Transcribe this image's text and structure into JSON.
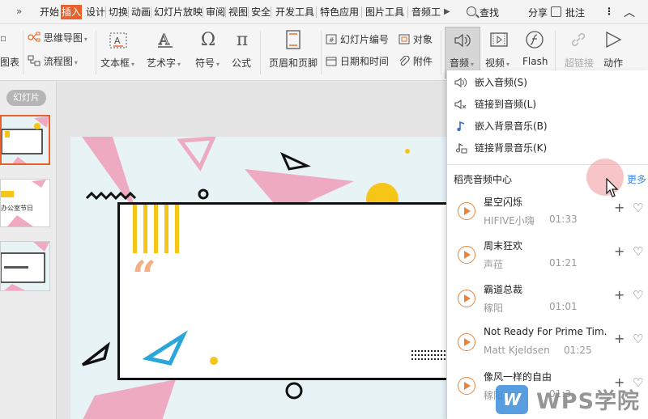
{
  "tabs": [
    "开始",
    "插入",
    "设计",
    "切换",
    "动画",
    "幻灯片放映",
    "审阅",
    "视图",
    "安全",
    "开发工具",
    "特色应用",
    "图片工具",
    "音频工"
  ],
  "active_tab": "插入",
  "tabbar_right": {
    "search": "查找",
    "share": "分享",
    "comment": "批注"
  },
  "ribbon": {
    "mindmap": "思维导图",
    "flowchart": "流程图",
    "chart_partial": "图表",
    "textbox": "文本框",
    "wordart": "艺术字",
    "symbol": "符号",
    "formula": "公式",
    "header_footer": "页眉和页脚",
    "slide_number": "幻灯片编号",
    "object": "对象",
    "date_time": "日期和时间",
    "attachment": "附件",
    "audio": "音频",
    "video": "视频",
    "flash": "Flash",
    "hyperlink": "超链接",
    "action": "动作"
  },
  "left_panel": {
    "label": "幻灯片",
    "thumb2_text": "办公室节日"
  },
  "slide": {
    "quote_mark": "“"
  },
  "audio_menu": {
    "items": [
      {
        "label": "嵌入音频(S)",
        "icon": "speaker-icon"
      },
      {
        "label": "链接到音频(L)",
        "icon": "speaker-link-icon"
      },
      {
        "label": "嵌入背景音乐(B)",
        "icon": "music-note-icon"
      },
      {
        "label": "链接背景音乐(K)",
        "icon": "music-link-icon"
      }
    ],
    "section_title": "稻壳音频中心",
    "more": "更多",
    "songs": [
      {
        "title": "星空闪烁",
        "artist": "HIFIVE小嗨",
        "duration": "01:33"
      },
      {
        "title": "周末狂欢",
        "artist": "声菈",
        "duration": "01:21"
      },
      {
        "title": "霸道总裁",
        "artist": "稼阳",
        "duration": "01:01"
      },
      {
        "title": "Not Ready For Prime Tim.",
        "artist": "Matt Kjeldsen",
        "duration": "01:25"
      },
      {
        "title": "像风一样的自由",
        "artist": "稼阳",
        "duration": "01:3"
      }
    ]
  },
  "watermark": {
    "mark": "W",
    "text": "WPS学院"
  },
  "colors": {
    "accent": "#e8602c",
    "link": "#3c8ce0",
    "play": "#e8843c"
  }
}
